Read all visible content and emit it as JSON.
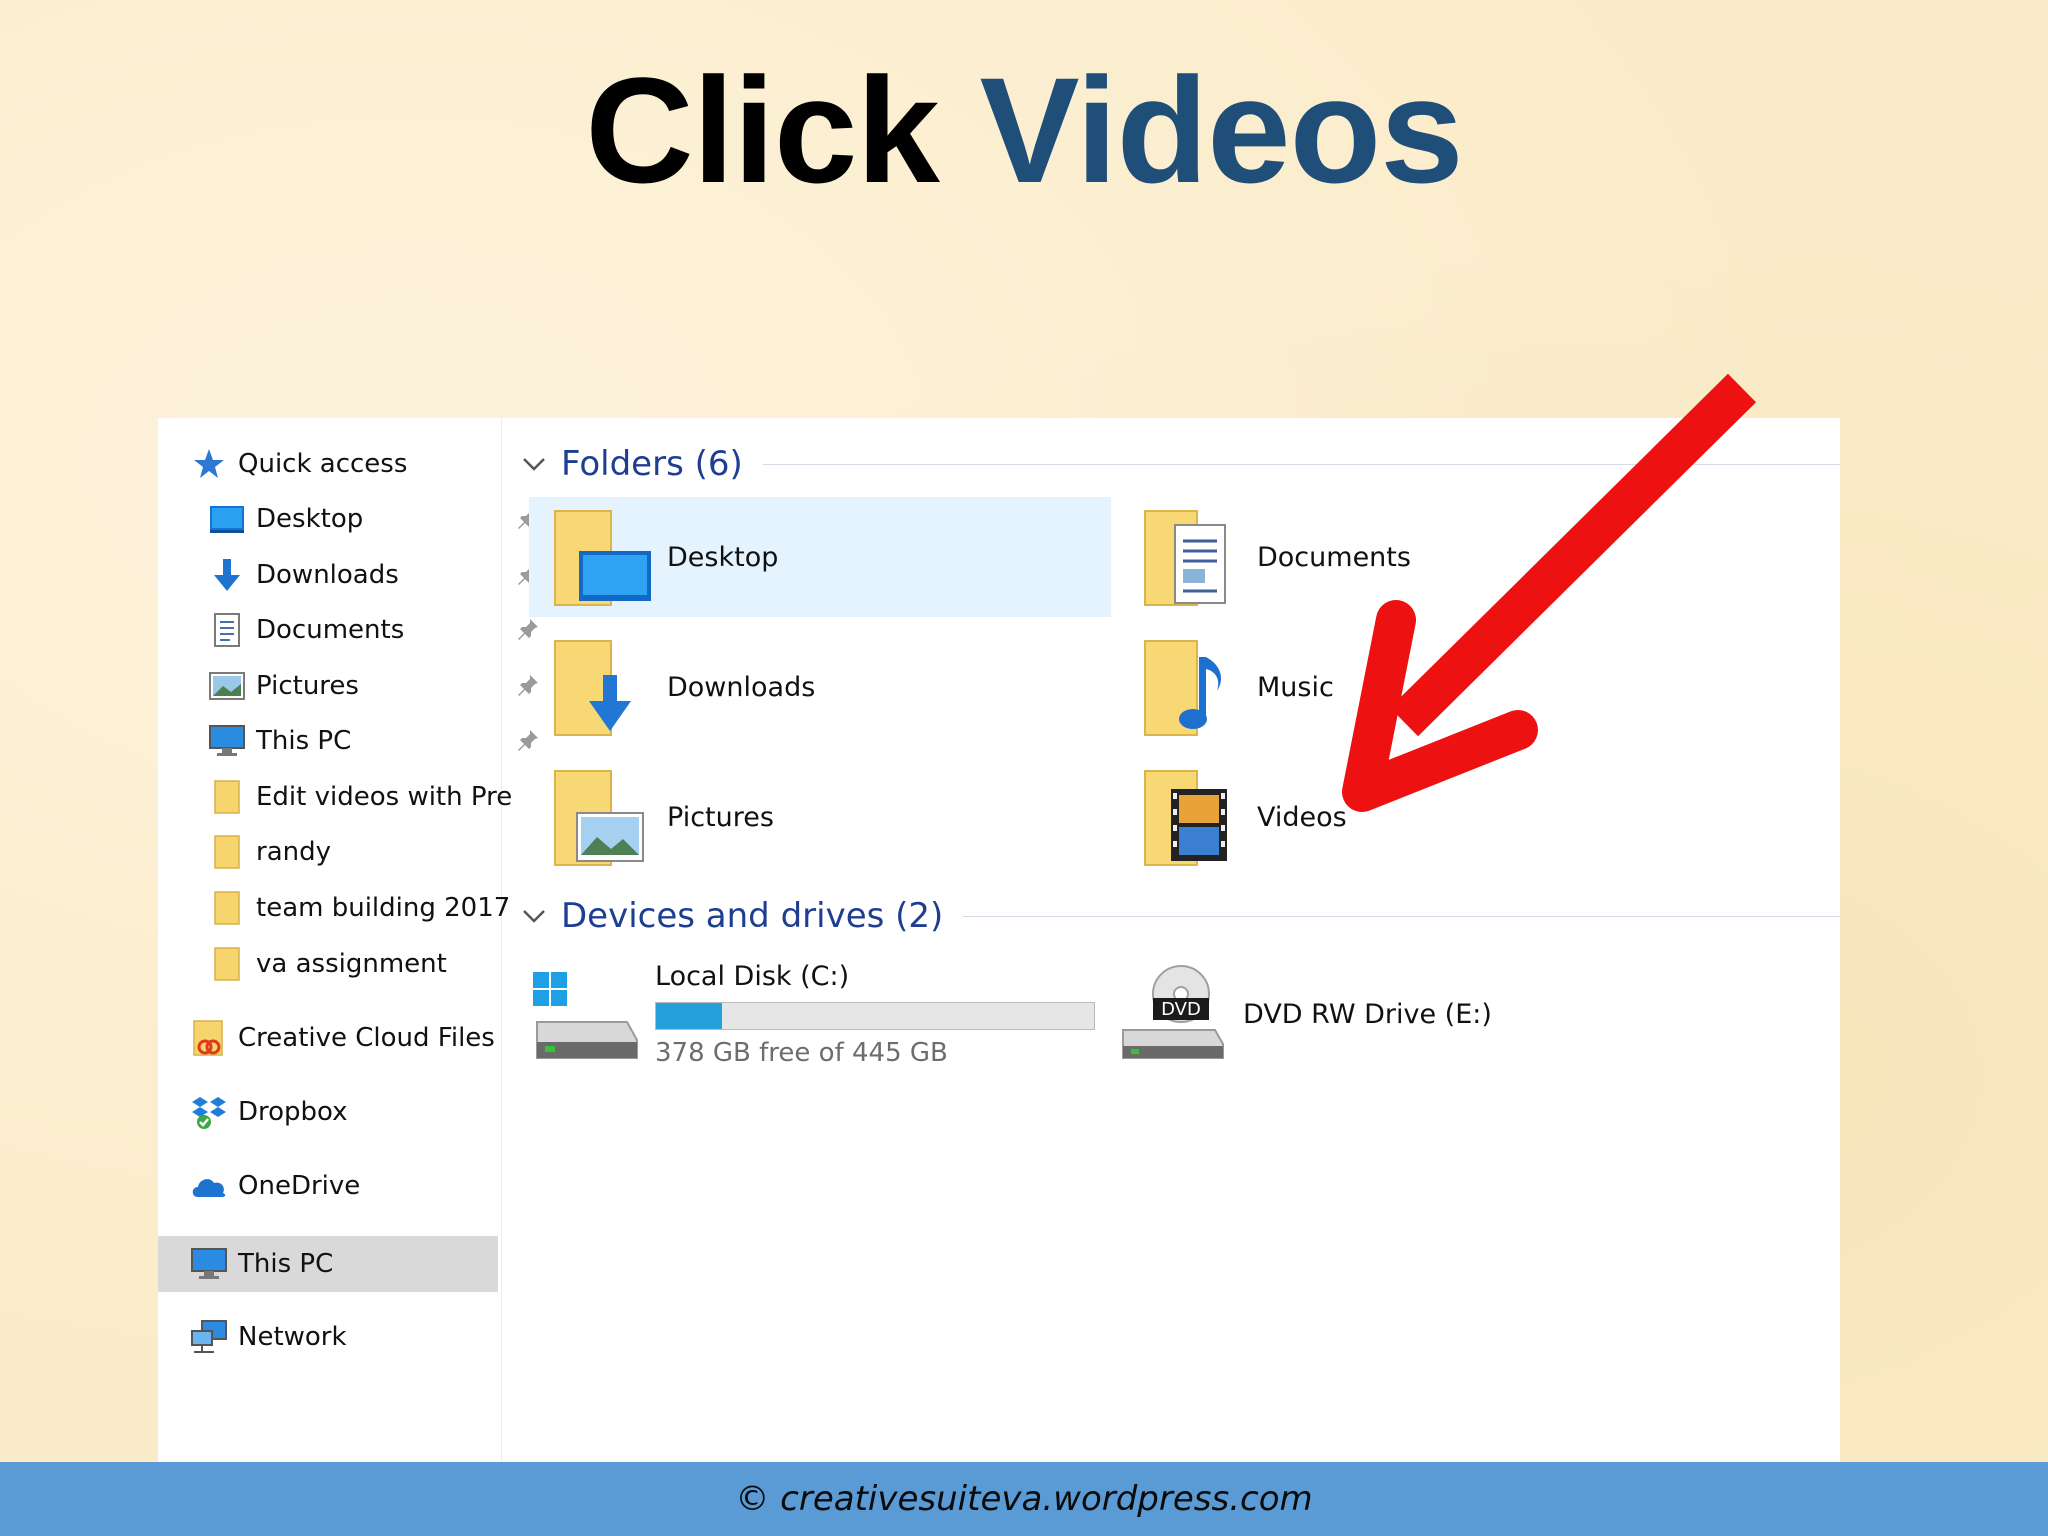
{
  "slide": {
    "title_prefix": "Click",
    "title_highlight": "Videos",
    "footer": "© creativesuiteva.wordpress.com"
  },
  "colors": {
    "title_highlight": "#1f4e79",
    "arrow": "#ee1111",
    "footer_bar": "#5b9bd5",
    "group_header": "#1e3e91",
    "selection": "#e5f3ff",
    "capacity_fill": "#26a0da"
  },
  "nav": {
    "items": [
      {
        "label": "Quick access",
        "icon": "star-icon",
        "pinned": false
      },
      {
        "label": "Desktop",
        "icon": "desktop-icon",
        "pinned": true
      },
      {
        "label": "Downloads",
        "icon": "download-arrow-icon",
        "pinned": true
      },
      {
        "label": "Documents",
        "icon": "document-icon",
        "pinned": true
      },
      {
        "label": "Pictures",
        "icon": "picture-icon",
        "pinned": true
      },
      {
        "label": "This PC",
        "icon": "monitor-icon",
        "pinned": true
      },
      {
        "label": "Edit videos with Pre",
        "icon": "folder-icon",
        "pinned": false
      },
      {
        "label": "randy",
        "icon": "folder-icon",
        "pinned": false
      },
      {
        "label": "team building 2017",
        "icon": "folder-icon",
        "pinned": false
      },
      {
        "label": "va assignment",
        "icon": "folder-icon",
        "pinned": false
      },
      {
        "label": "Creative Cloud Files",
        "icon": "creative-cloud-icon",
        "pinned": false
      },
      {
        "label": "Dropbox",
        "icon": "dropbox-icon",
        "pinned": false
      },
      {
        "label": "OneDrive",
        "icon": "onedrive-cloud-icon",
        "pinned": false
      },
      {
        "label": "This PC",
        "icon": "monitor-icon",
        "pinned": false,
        "selected": true
      },
      {
        "label": "Network",
        "icon": "network-icon",
        "pinned": false
      }
    ]
  },
  "folders_group": {
    "header": "Folders (6)",
    "items": [
      {
        "label": "Desktop",
        "icon": "desktop-folder-icon",
        "selected": true
      },
      {
        "label": "Documents",
        "icon": "documents-folder-icon"
      },
      {
        "label": "Downloads",
        "icon": "downloads-folder-icon"
      },
      {
        "label": "Music",
        "icon": "music-folder-icon"
      },
      {
        "label": "Pictures",
        "icon": "pictures-folder-icon"
      },
      {
        "label": "Videos",
        "icon": "videos-folder-icon"
      }
    ]
  },
  "devices_group": {
    "header": "Devices and drives (2)",
    "drives": [
      {
        "label": "Local Disk (C:)",
        "icon": "hard-drive-icon",
        "free_text": "378 GB free of 445 GB",
        "used_fraction": 0.151
      },
      {
        "label": "DVD RW Drive (E:)",
        "icon": "dvd-drive-icon",
        "badge": "DVD"
      }
    ]
  }
}
